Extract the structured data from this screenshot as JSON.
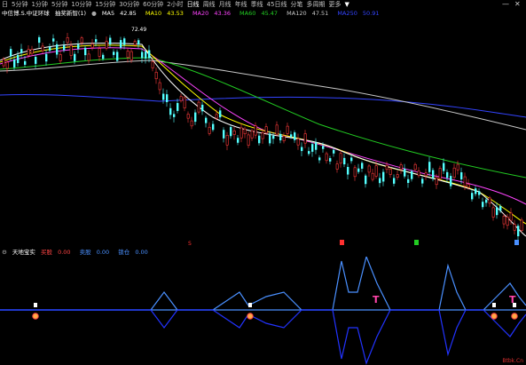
{
  "toolbar": {
    "items": [
      "日",
      "5分钟",
      "1分钟",
      "5分钟",
      "10分钟",
      "15分钟",
      "30分钟",
      "60分钟",
      "2小时",
      "日线",
      "周线",
      "月线",
      "年线",
      "季线",
      "45日线",
      "分笔",
      "多周期",
      "更多"
    ],
    "active_index": 9,
    "fold_icon": "collapse-arrow-icon"
  },
  "window_controls": {
    "minimize": "—",
    "close": "✕"
  },
  "legend": {
    "title": "中信博.S.中证环球",
    "subtitle": "抽奖新智(1)",
    "ma5_label": "MA5",
    "ma5_value": "42.85",
    "ma10_label": "MA10",
    "ma10_value": "43.53",
    "ma20_label": "MA20",
    "ma20_value": "43.36",
    "ma60_label": "MA60",
    "ma60_value": "45.47",
    "ma120_label": "MA120",
    "ma120_value": "47.51",
    "ma250_label": "MA250",
    "ma250_value": "50.91",
    "colors": {
      "ma5": "#ffffff",
      "ma10": "#ffff00",
      "ma20": "#ff44ff",
      "ma60": "#22cc22",
      "ma120": "#c8c8c8",
      "ma250": "#3344ff"
    }
  },
  "price_marker": "72.49",
  "sub_legend": {
    "name": "天地宝实",
    "v1_label": "买股",
    "v1_value": "0.00",
    "v2_label": "卖股",
    "v2_value": "0.00",
    "v3_label": "锁仓",
    "v3_value": "0.00",
    "colors": {
      "v1": "#ff4444",
      "v2": "#4a90ff",
      "v3": "#4a90ff"
    }
  },
  "watermark": "Btbk.Cn"
}
